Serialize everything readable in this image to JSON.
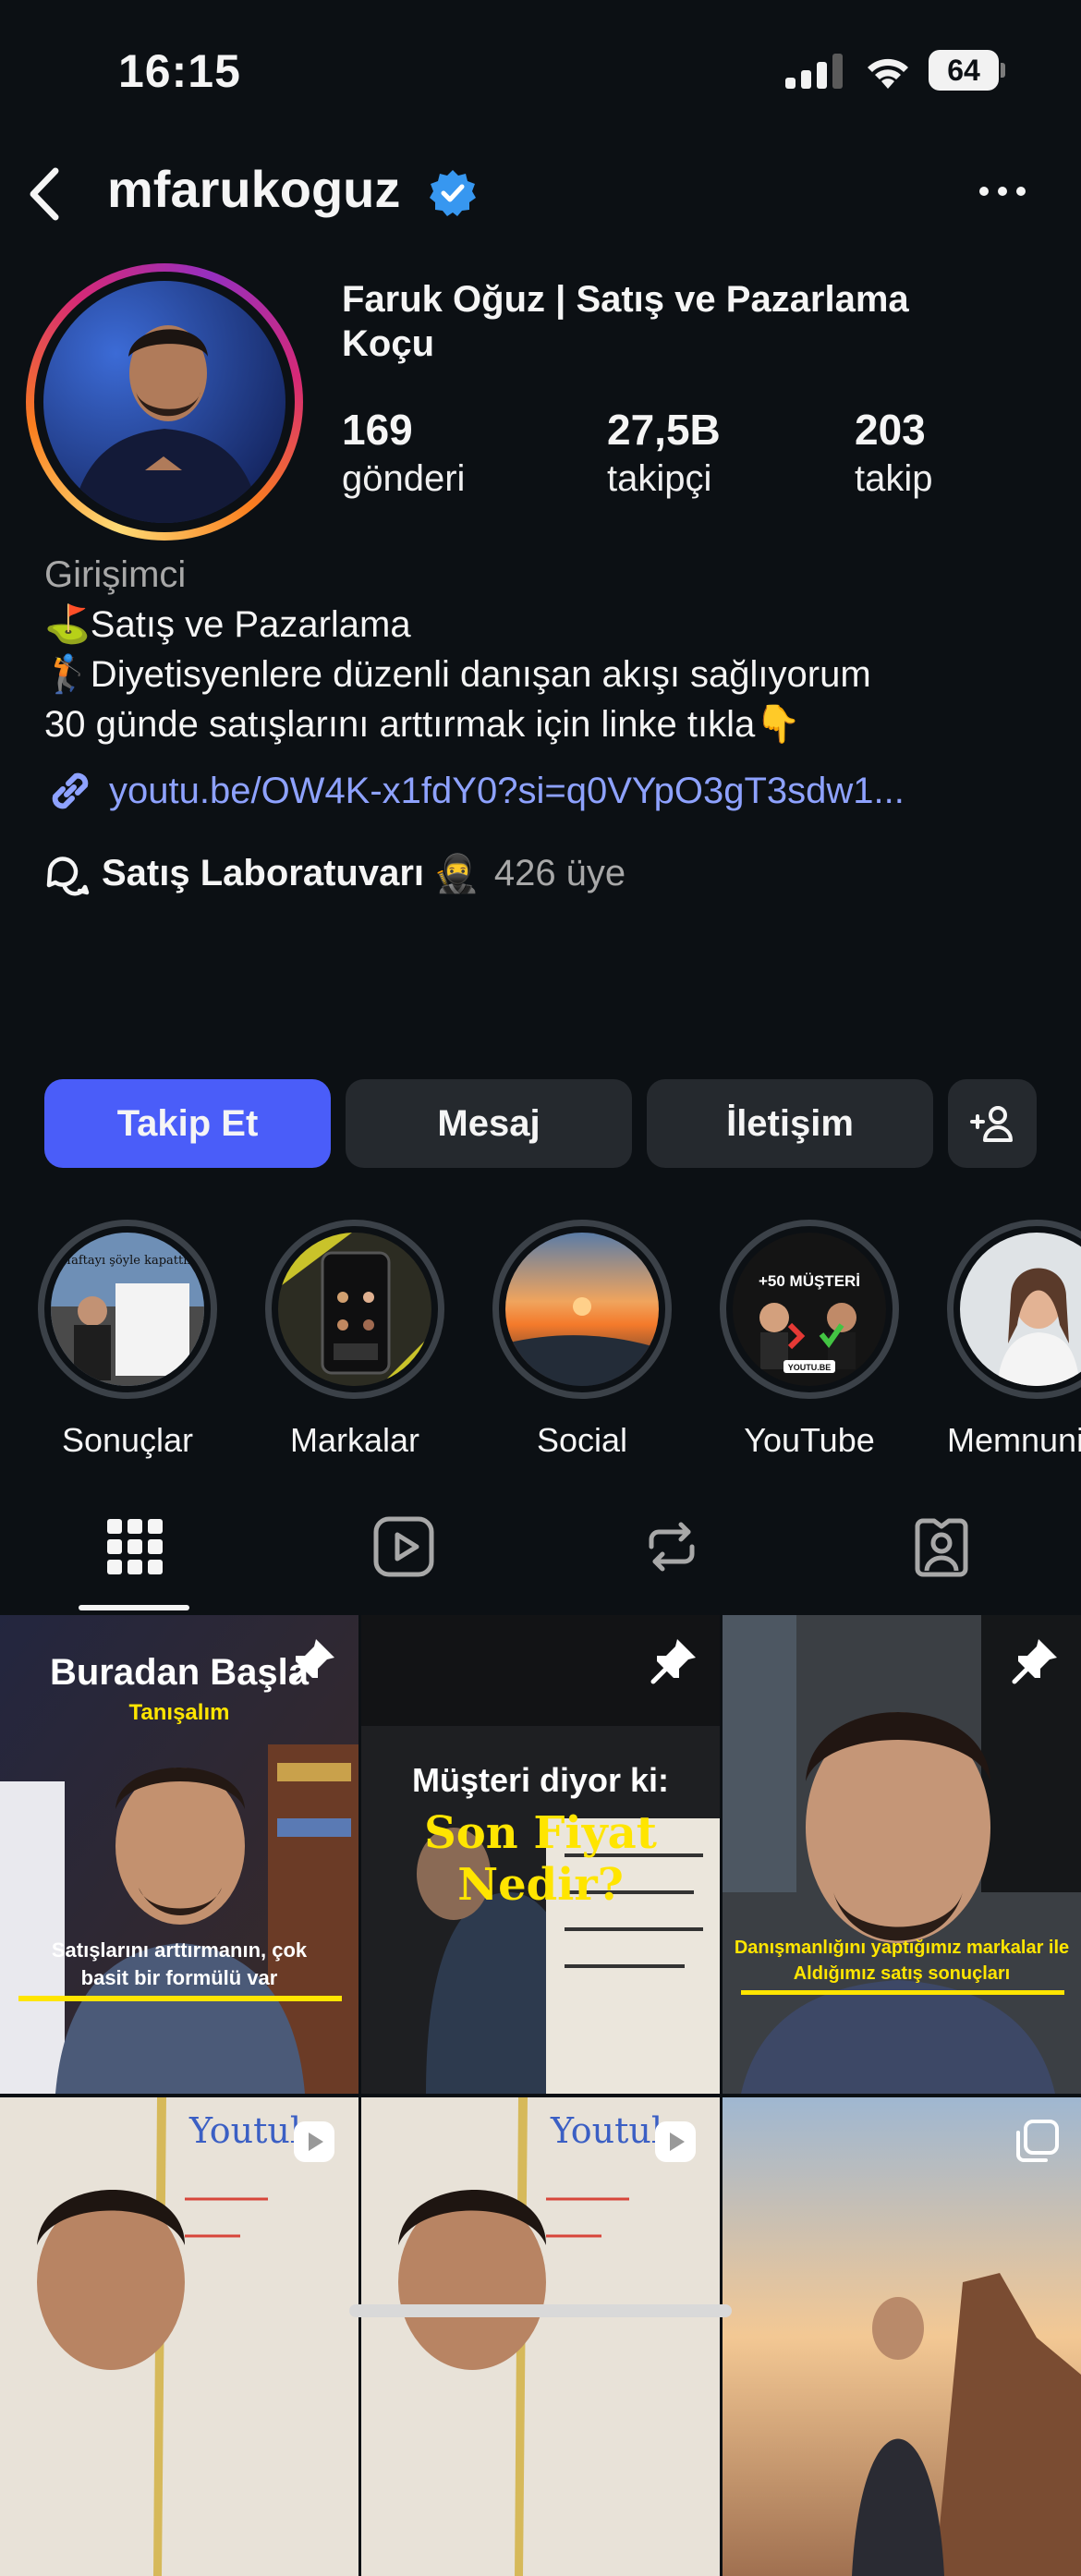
{
  "status_bar": {
    "time": "16:15",
    "battery": "64"
  },
  "header": {
    "username": "mfarukoguz"
  },
  "profile": {
    "full_name": "Faruk Oğuz | Satış ve Pazarlama Koçu",
    "stats": {
      "posts": {
        "value": "169",
        "label": "gönderi"
      },
      "followers": {
        "value": "27,5B",
        "label": "takipçi"
      },
      "following": {
        "value": "203",
        "label": "takip"
      }
    },
    "category": "Girişimci",
    "bio": [
      "⛳Satış ve Pazarlama",
      "🏌️Diyetisyenlere düzenli danışan akışı sağlıyorum",
      "30 günde satışlarını arttırmak için linke tıkla👇"
    ],
    "link": "youtu.be/OW4K-x1fdY0?si=q0VYpO3gT3sdw1...",
    "channel": {
      "name": "Satış Laboratuvarı",
      "emoji": "🥷",
      "members": "426 üye"
    }
  },
  "actions": {
    "follow": "Takip Et",
    "message": "Mesaj",
    "contact": "İletişim"
  },
  "highlights": [
    {
      "label": "Sonuçlar",
      "caption": "Haftayı şöyle kapattık"
    },
    {
      "label": "Markalar"
    },
    {
      "label": "Social"
    },
    {
      "label": "YouTube",
      "caption": "+50 MÜŞTERİ",
      "badge": "YOUTU.BE"
    },
    {
      "label": "Memnuni"
    }
  ],
  "grid": [
    {
      "caption_top": "Buradan Başla",
      "caption_sub": "Tanışalım",
      "caption_bottom": "Satışlarını arttırmanın, çok basit bir formülü var",
      "pinned": true
    },
    {
      "caption_top": "Müşteri diyor ki:",
      "caption_sub": "Son Fiyat Nedir?",
      "pinned": true
    },
    {
      "caption_bottom": "Danışmanlığını yaptığımız markalar ile Aldığımız satış sonuçları",
      "pinned": true
    },
    {
      "board_text": "Youtube",
      "type": "reel"
    },
    {
      "board_text": "Youtube",
      "type": "reel"
    },
    {
      "type": "carousel"
    }
  ],
  "colors": {
    "background": "#0c1014",
    "follow_button": "#4a5df9",
    "secondary_button": "#25292e",
    "link": "#8ea2ff",
    "verified": "#3797f0"
  }
}
